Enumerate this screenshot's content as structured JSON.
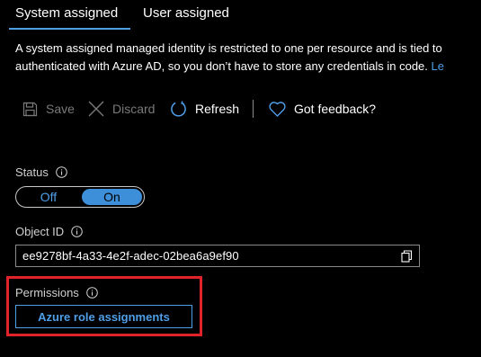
{
  "tabs": {
    "system_assigned": "System assigned",
    "user_assigned": "User assigned",
    "active": "System assigned"
  },
  "description": {
    "line1": "A system assigned managed identity is restricted to one per resource and is tied to",
    "line2": "authenticated with Azure AD, so you don’t have to store any credentials in code. ",
    "link": "Le"
  },
  "toolbar": {
    "save": "Save",
    "discard": "Discard",
    "refresh": "Refresh",
    "feedback": "Got feedback?",
    "icons": {
      "save": "save-icon",
      "discard": "close-icon",
      "refresh": "refresh-icon",
      "feedback": "heart-icon"
    }
  },
  "status": {
    "label": "Status",
    "off_label": "Off",
    "on_label": "On",
    "value": "On"
  },
  "object_id": {
    "label": "Object ID",
    "value": "ee9278bf-4a33-4e2f-adec-02bea6a9ef90"
  },
  "permissions": {
    "label": "Permissions",
    "button": "Azure role assignments"
  },
  "colors": {
    "background": "#000000",
    "accent": "#4f9ee8",
    "toggle_on": "#3d8fd9",
    "highlight": "#e0222b",
    "disabled": "#7a7a7a"
  }
}
